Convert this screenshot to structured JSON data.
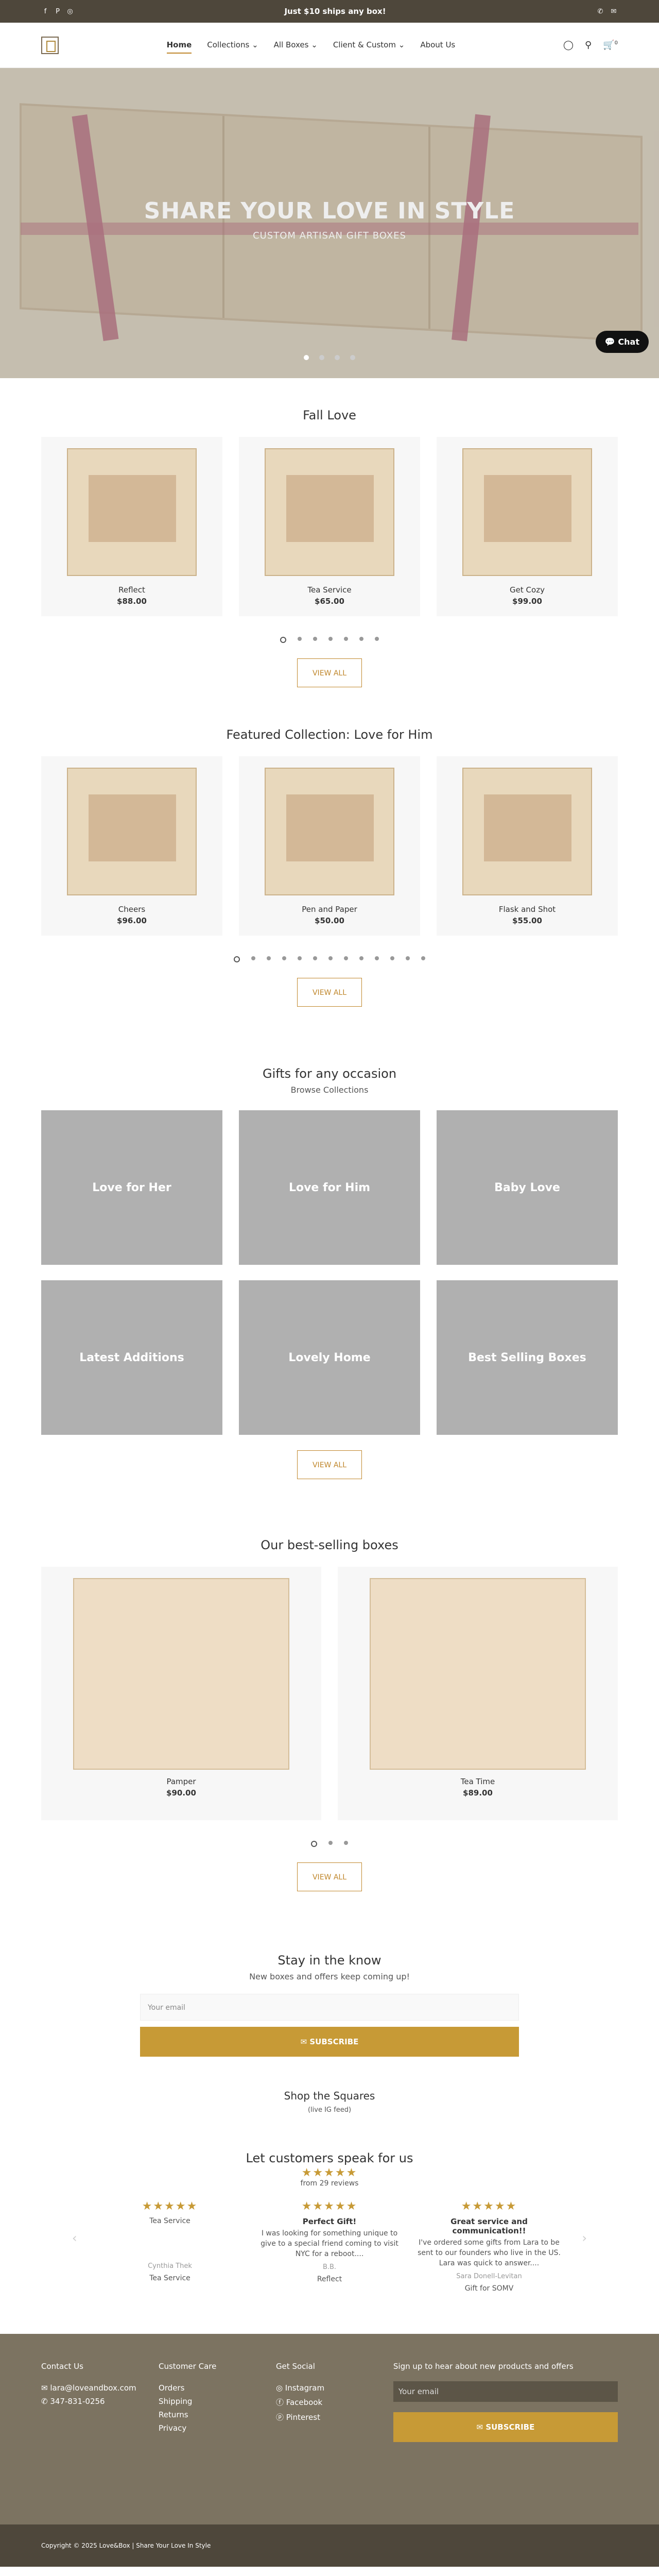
{
  "topbar": {
    "message": "Just $10 ships any box!",
    "social": [
      "facebook-icon",
      "pinterest-icon",
      "instagram-icon"
    ],
    "contact": [
      "phone-icon",
      "mail-icon"
    ]
  },
  "nav": {
    "items": [
      "Home",
      "Collections",
      "All Boxes",
      "Client & Custom",
      "About Us"
    ]
  },
  "header": {
    "cart_count": "0"
  },
  "hero": {
    "title": "SHARE YOUR LOVE IN STYLE",
    "subtitle": "CUSTOM ARTISAN GIFT BOXES",
    "chat": "Chat"
  },
  "fall": {
    "title": "Fall Love",
    "products": [
      {
        "name": "Reflect",
        "price": "$88.00"
      },
      {
        "name": "Tea Service",
        "price": "$65.00"
      },
      {
        "name": "Get Cozy",
        "price": "$99.00"
      }
    ],
    "view": "VIEW ALL"
  },
  "featured": {
    "title": "Featured Collection: Love for Him",
    "products": [
      {
        "name": "Cheers",
        "price": "$96.00"
      },
      {
        "name": "Pen and Paper",
        "price": "$50.00"
      },
      {
        "name": "Flask and Shot",
        "price": "$55.00"
      }
    ],
    "view": "VIEW ALL"
  },
  "gifts": {
    "title": "Gifts for any occasion",
    "subtitle": "Browse Collections",
    "collections": [
      "Love for Her",
      "Love for Him",
      "Baby Love",
      "Latest Additions",
      "Lovely Home",
      "Best Selling Boxes"
    ],
    "view": "VIEW ALL"
  },
  "best": {
    "title": "Our best-selling boxes",
    "products": [
      {
        "name": "Pamper",
        "price": "$90.00"
      },
      {
        "name": "Tea Time",
        "price": "$89.00"
      }
    ],
    "view": "VIEW ALL"
  },
  "know": {
    "title": "Stay in the know",
    "subtitle": "New boxes and offers keep coming up!",
    "placeholder": "Your email",
    "button": "✉ SUBSCRIBE"
  },
  "squares": {
    "title": "Shop the Squares",
    "subtitle": "(live IG feed)"
  },
  "reviews": {
    "title": "Let customers speak for us",
    "count": "from 29 reviews",
    "stars": "★★★★★",
    "items": [
      {
        "title": "Tea Service",
        "body": "",
        "author": "Cynthia Thek",
        "product": "Tea Service"
      },
      {
        "title": "Perfect Gift!",
        "body": "I was looking for something unique to give to a special friend coming to visit NYC for a reboot....",
        "author": "B.B.",
        "product": "Reflect"
      },
      {
        "title": "Great service and communication!!",
        "body": "I've ordered some gifts from Lara to be sent to our founders who live in the US. Lara was quick to answer....",
        "author": "Sara Donell-Levitan",
        "product": "Gift for SOMV"
      }
    ]
  },
  "footer": {
    "contact": {
      "h": "Contact Us",
      "email": "lara@loveandbox.com",
      "phone": "347-831-0256"
    },
    "care": {
      "h": "Customer Care",
      "items": [
        "Orders",
        "Shipping",
        "Returns",
        "Privacy"
      ]
    },
    "social": {
      "h": "Get Social",
      "items": [
        "Instagram",
        "Facebook",
        "Pinterest"
      ]
    },
    "news": {
      "h": "Sign up to hear about new products and offers",
      "placeholder": "Your email",
      "button": "✉ SUBSCRIBE"
    }
  },
  "copyright": "Copyright © 2025 Love&Box | Share Your Love In Style"
}
